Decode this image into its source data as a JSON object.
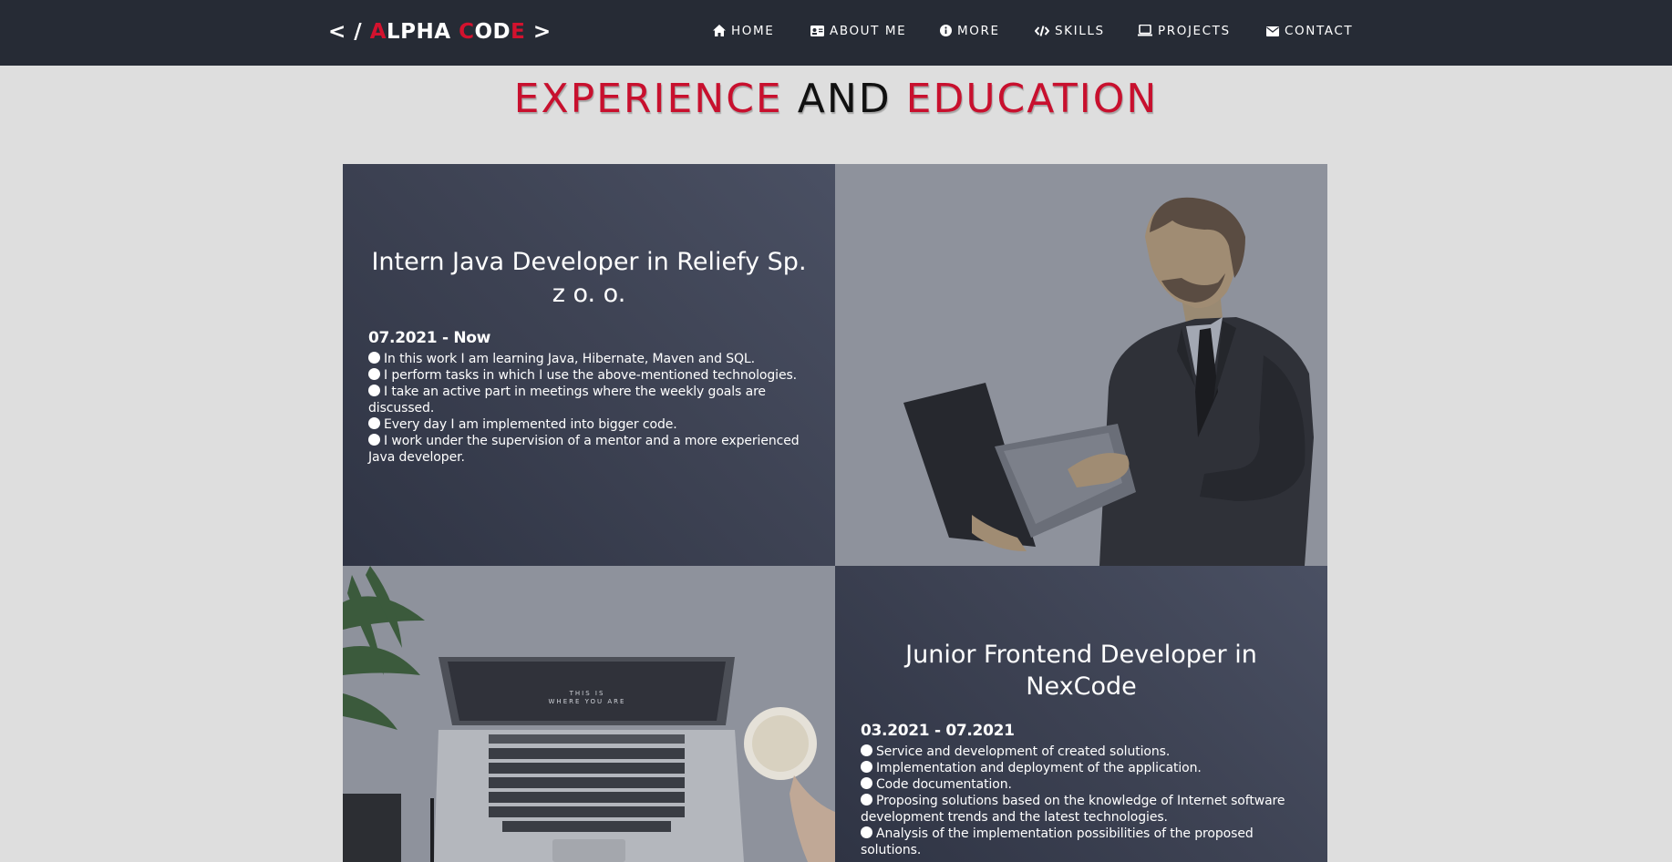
{
  "logo": {
    "prefix": "< / ",
    "parts": [
      "A",
      "LPHA ",
      "C",
      "OD",
      "E",
      " >"
    ]
  },
  "nav": [
    {
      "label": "HOME",
      "icon": "home-icon"
    },
    {
      "label": "ABOUT ME",
      "icon": "id-card-icon"
    },
    {
      "label": "MORE",
      "icon": "info-circle-icon"
    },
    {
      "label": "SKILLS",
      "icon": "code-icon"
    },
    {
      "label": "PROJECTS",
      "icon": "laptop-icon"
    },
    {
      "label": "CONTACT",
      "icon": "envelope-icon"
    }
  ],
  "heading": {
    "word1": "EXPERIENCE",
    "word2": "AND",
    "word3": "EDUCATION"
  },
  "jobs": [
    {
      "title": "Intern Java Developer in Reliefy Sp. z o. o.",
      "date": "07.2021 - Now",
      "duties": [
        "In this work I am learning Java, Hibernate, Maven and SQL.",
        "I perform tasks in which I use the above-mentioned technologies.",
        "I take an active part in meetings where the weekly goals are discussed.",
        "Every day I am implemented into bigger code.",
        "I work under the supervision of a mentor and a more experienced Java developer."
      ]
    },
    {
      "title": "Junior Frontend Developer in NexCode",
      "date": "03.2021 - 07.2021",
      "duties": [
        "Service and development of created solutions.",
        "Implementation and deployment of the application.",
        "Code documentation.",
        "Proposing solutions based on the knowledge of Internet software development trends and the latest technologies.",
        "Analysis of the implementation possibilities of the proposed solutions."
      ]
    }
  ],
  "laptop_screen_text": {
    "line1": "THIS IS",
    "line2": "WHERE YOU ARE"
  },
  "colors": {
    "accent": "#c8102e",
    "navbar": "#262b35",
    "background": "#dedede"
  }
}
